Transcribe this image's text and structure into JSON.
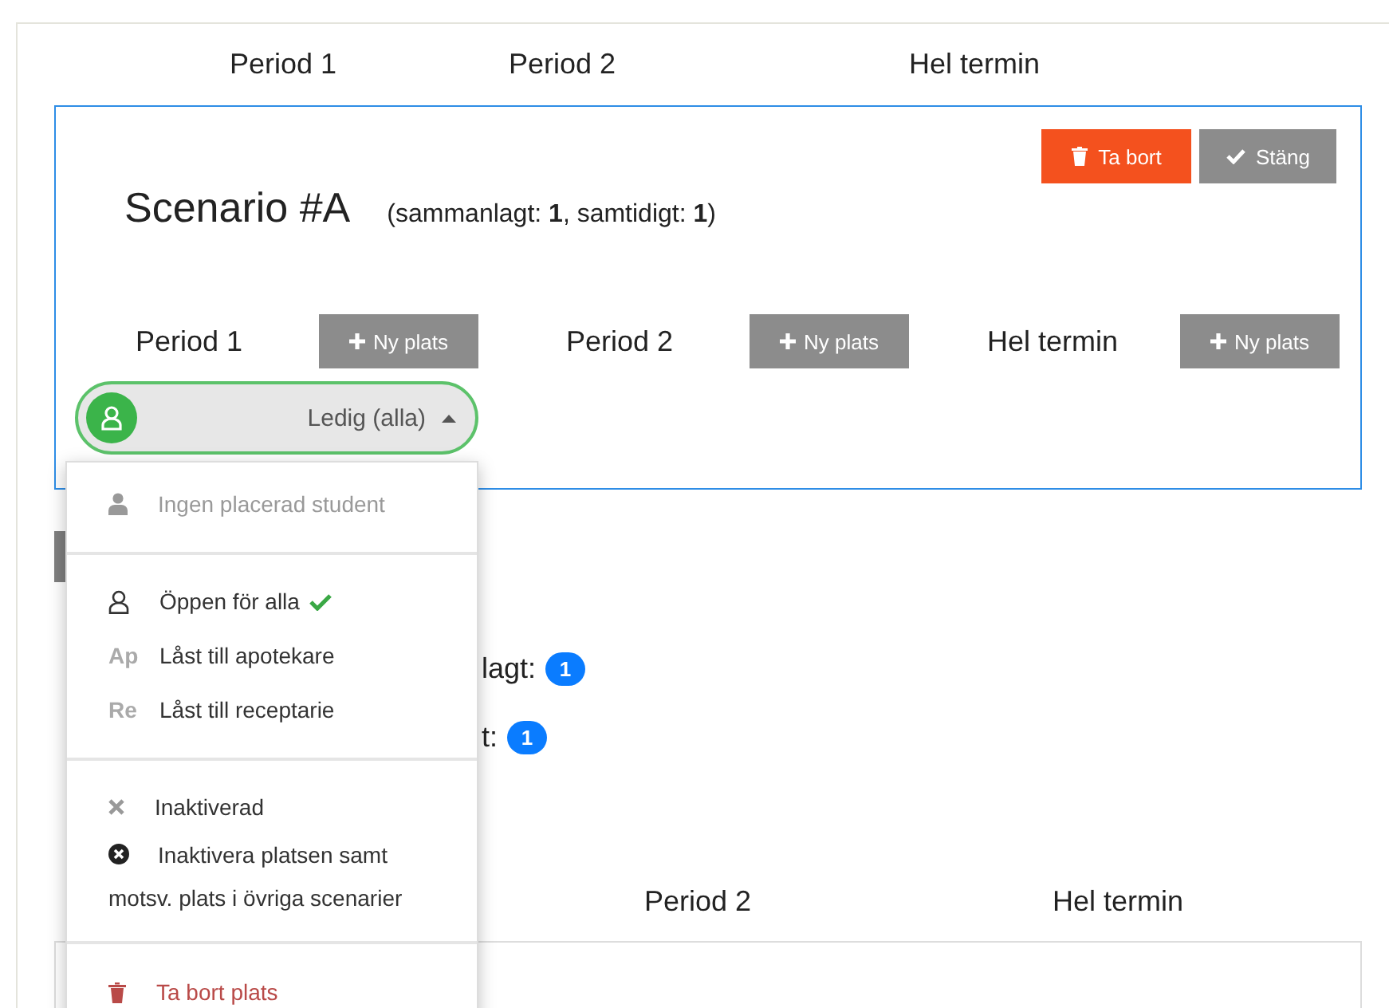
{
  "top_header": {
    "periods": [
      "Period 1",
      "Period 2",
      "Hel termin"
    ]
  },
  "scenario": {
    "title": "Scenario #A",
    "summary": "(sammanlagt: **1**, samtidigt: **1**)",
    "actions": [
      {
        "label": "Ta bort",
        "kind": "delete"
      },
      {
        "label": "Stäng",
        "kind": "close"
      }
    ],
    "periods": [
      {
        "label": "Period 1",
        "button": "Ny plats"
      },
      {
        "label": "Period 2",
        "button": "Ny plats"
      },
      {
        "label": "Hel termin",
        "button": "Ny plats"
      }
    ],
    "slot": {
      "label": "Ledig (alla)",
      "expanded": true
    }
  },
  "dropdown": {
    "sections": [
      {
        "items": [
          {
            "kind": "student",
            "label": "Ingen placerad student",
            "disabled": true,
            "selected": false
          }
        ]
      },
      {
        "items": [
          {
            "kind": "open",
            "label": "Öppen för alla",
            "disabled": false,
            "selected": true
          },
          {
            "kind": "tag",
            "tag": "Ap",
            "label": "Låst till apotekare",
            "disabled": false,
            "selected": false
          },
          {
            "kind": "tag",
            "tag": "Re",
            "label": "Låst till receptarie",
            "disabled": false,
            "selected": false
          }
        ]
      },
      {
        "items": [
          {
            "kind": "inactive",
            "label": "Inaktiverad",
            "disabled": false,
            "selected": false
          },
          {
            "kind": "inactive-all",
            "label": "Inaktivera platsen samt motsv. plats i övriga scenarier",
            "disabled": false,
            "selected": false
          }
        ]
      },
      {
        "items": [
          {
            "kind": "delete",
            "label": "Ta bort plats",
            "disabled": false,
            "selected": false
          }
        ]
      }
    ]
  },
  "behind": {
    "rows": [
      {
        "tail": "lagt:",
        "count": "1"
      },
      {
        "tail": "t:",
        "count": "1"
      }
    ],
    "columns": [
      "Period 2",
      "Hel termin"
    ]
  }
}
